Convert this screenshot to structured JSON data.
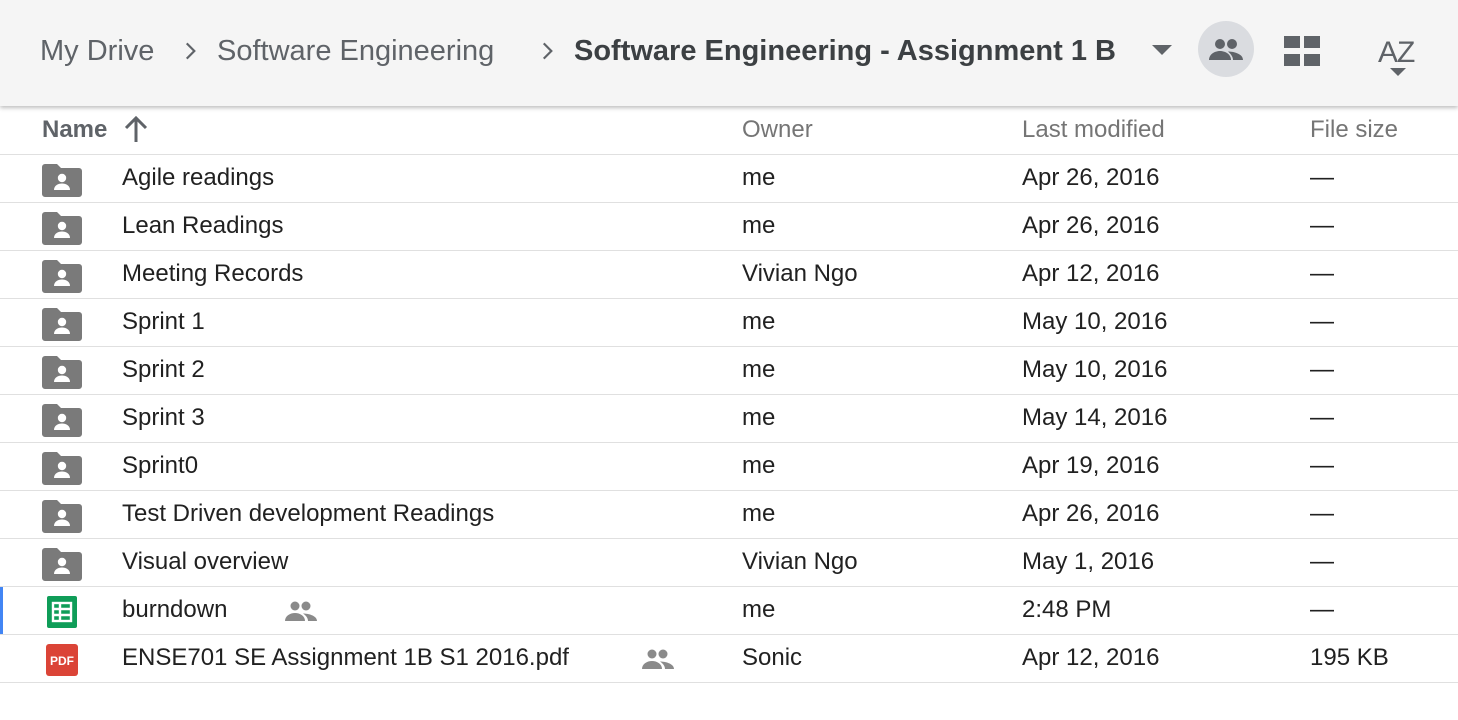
{
  "breadcrumb": {
    "root": "My Drive",
    "parent": "Software Engineering",
    "current": "Software Engineering - Assignment 1 B"
  },
  "toolbar": {
    "share_icon": "people-icon",
    "view_icon": "grid-view-icon",
    "sort_icon": "sort-az-icon"
  },
  "columns": {
    "name": "Name",
    "owner": "Owner",
    "modified": "Last modified",
    "size": "File size"
  },
  "sort": {
    "column": "Name",
    "direction": "ascending"
  },
  "files": [
    {
      "name": "Agile readings",
      "type": "shared-folder",
      "owner": "me",
      "modified": "Apr 26, 2016",
      "size": "—"
    },
    {
      "name": "Lean Readings",
      "type": "shared-folder",
      "owner": "me",
      "modified": "Apr 26, 2016",
      "size": "—"
    },
    {
      "name": "Meeting Records",
      "type": "shared-folder",
      "owner": "Vivian Ngo",
      "modified": "Apr 12, 2016",
      "size": "—"
    },
    {
      "name": "Sprint 1",
      "type": "shared-folder",
      "owner": "me",
      "modified": "May 10, 2016",
      "size": "—"
    },
    {
      "name": "Sprint 2",
      "type": "shared-folder",
      "owner": "me",
      "modified": "May 10, 2016",
      "size": "—"
    },
    {
      "name": "Sprint 3",
      "type": "shared-folder",
      "owner": "me",
      "modified": "May 14, 2016",
      "size": "—"
    },
    {
      "name": "Sprint0",
      "type": "shared-folder",
      "owner": "me",
      "modified": "Apr 19, 2016",
      "size": "—"
    },
    {
      "name": "Test Driven development Readings",
      "type": "shared-folder",
      "owner": "me",
      "modified": "Apr 26, 2016",
      "size": "—"
    },
    {
      "name": "Visual overview",
      "type": "shared-folder",
      "owner": "Vivian Ngo",
      "modified": "May 1, 2016",
      "size": "—"
    },
    {
      "name": "burndown",
      "type": "sheet",
      "shared": true,
      "selected": true,
      "owner": "me",
      "modified": "2:48 PM",
      "size": "—"
    },
    {
      "name": "ENSE701 SE Assignment 1B S1 2016.pdf",
      "type": "pdf",
      "shared": true,
      "owner": "Sonic",
      "modified": "Apr 12, 2016",
      "size": "195 KB"
    }
  ],
  "pdf_badge": "PDF",
  "colors": {
    "folder": "#7a7a7a",
    "sheet": "#0f9d58",
    "pdf": "#db4437",
    "selected_accent": "#4285f4"
  }
}
